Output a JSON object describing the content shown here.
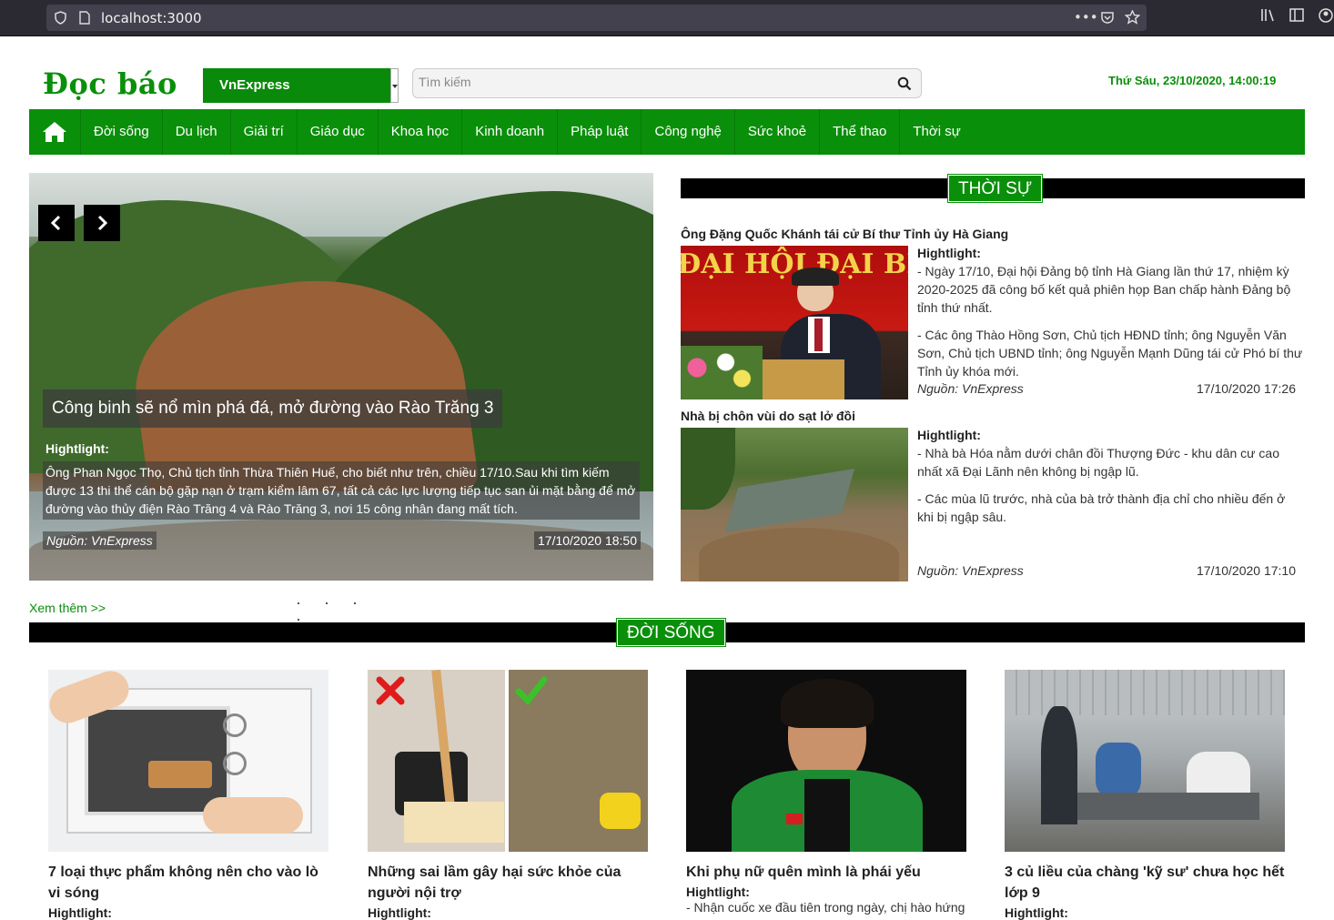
{
  "browser": {
    "url": "localhost:3000",
    "menu_dots": "•••"
  },
  "header": {
    "logo": "Đọc báo",
    "source": "VnExpress",
    "search_placeholder": "Tìm kiếm",
    "datetime": "Thứ Sáu, 23/10/2020, 14:00:19"
  },
  "nav": {
    "items": [
      "Đời sống",
      "Du lịch",
      "Giải trí",
      "Giáo dục",
      "Khoa học",
      "Kinh doanh",
      "Pháp luật",
      "Công nghệ",
      "Sức khoẻ",
      "Thể thao",
      "Thời sự"
    ]
  },
  "slider": {
    "title": "Công binh sẽ nổ mìn phá đá, mở đường vào Rào Trăng 3",
    "hl_label": "Hightlight:",
    "desc": "Ông Phan Ngọc Thọ, Chủ tịch tỉnh Thừa Thiên Huế, cho biết như trên, chiều 17/10.Sau khi tìm kiếm được 13 thi thể cán bộ gặp nạn ở trạm kiểm lâm 67, tất cả các lực lượng tiếp tục san ủi mặt bằng để mở đường vào thủy điện Rào Trăng 4 và Rào Trăng 3, nơi 15 công nhân đang mất tích.",
    "source": "Nguồn: VnExpress",
    "date": "17/10/2020 18:50",
    "see_more": "Xem thêm >>"
  },
  "thoisu": {
    "label": "THỜI SỰ",
    "articles": [
      {
        "title": "Ông Đặng Quốc Khánh tái cử Bí thư Tỉnh ủy Hà Giang",
        "hl_label": "Hightlight:",
        "p1": "- Ngày 17/10, Đại hội Đảng bộ tỉnh Hà Giang lần thứ 17, nhiệm kỳ 2020-2025 đã công bố kết quả phiên họp Ban chấp hành Đảng bộ tỉnh thứ nhất.",
        "p2": "- Các ông Thào Hồng Sơn, Chủ tịch HĐND tỉnh; ông Nguyễn Văn Sơn, Chủ tịch UBND tỉnh; ông Nguyễn Mạnh Dũng tái cử Phó bí thư Tỉnh ủy khóa mới.",
        "source": "Nguồn: VnExpress",
        "date": "17/10/2020 17:26",
        "banner_text": "ĐẠI HỘI ĐẠI BIỂU LẦN"
      },
      {
        "title": "Nhà bị chôn vùi do sạt lở đồi",
        "hl_label": "Hightlight:",
        "p1": "- Nhà bà Hóa nằm dưới chân đồi Thượng Đức - khu dân cư cao nhất xã Đại Lãnh nên không bị ngập lũ.",
        "p2": "- Các mùa lũ trước, nhà của bà trở thành địa chỉ cho nhiều đến ở khi bị ngập sâu.",
        "source": "Nguồn: VnExpress",
        "date": "17/10/2020 17:10"
      }
    ]
  },
  "doisong": {
    "label": "ĐỜI SỐNG",
    "cards": [
      {
        "title": "7 loại thực phẩm không nên cho vào lò vi sóng",
        "hl_label": "Hightlight:",
        "desc": ""
      },
      {
        "title": "Những sai lầm gây hại sức khỏe của người nội trợ",
        "hl_label": "Hightlight:",
        "desc": ""
      },
      {
        "title": "Khi phụ nữ quên mình là phái yếu",
        "hl_label": "Hightlight:",
        "desc": "- Nhận cuốc xe đầu tiên trong ngày, chị hào hứng"
      },
      {
        "title": "3 củ liều của chàng 'kỹ sư' chưa học hết lớp 9",
        "hl_label": "Hightlight:",
        "desc": ""
      }
    ]
  }
}
